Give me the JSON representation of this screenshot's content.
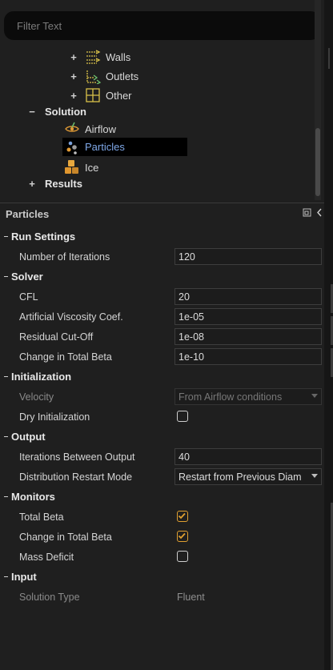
{
  "search": {
    "placeholder": "Filter Text"
  },
  "tree": {
    "items": [
      {
        "label": "Walls"
      },
      {
        "label": "Outlets"
      },
      {
        "label": "Other"
      },
      {
        "label": "Solution"
      },
      {
        "label": "Airflow"
      },
      {
        "label": "Particles"
      },
      {
        "label": "Ice"
      },
      {
        "label": "Results"
      }
    ]
  },
  "panel": {
    "title": "Particles"
  },
  "sections": {
    "run_settings": {
      "title": "Run Settings",
      "iterations_label": "Number of Iterations",
      "iterations_value": "120"
    },
    "solver": {
      "title": "Solver",
      "cfl_label": "CFL",
      "cfl_value": "20",
      "viscosity_label": "Artificial Viscosity Coef.",
      "viscosity_value": "1e-05",
      "residual_label": "Residual Cut-Off",
      "residual_value": "1e-08",
      "beta_label": "Change in Total Beta",
      "beta_value": "1e-10"
    },
    "initialization": {
      "title": "Initialization",
      "velocity_label": "Velocity",
      "velocity_value": "From Airflow conditions",
      "dry_label": "Dry Initialization",
      "dry_checked": false
    },
    "output": {
      "title": "Output",
      "iterations_label": "Iterations Between Output",
      "iterations_value": "40",
      "restart_label": "Distribution Restart Mode",
      "restart_value": "Restart from Previous Diam"
    },
    "monitors": {
      "title": "Monitors",
      "total_beta_label": "Total Beta",
      "total_beta_checked": true,
      "change_beta_label": "Change in Total Beta",
      "change_beta_checked": true,
      "mass_deficit_label": "Mass Deficit",
      "mass_deficit_checked": false
    },
    "input": {
      "title": "Input",
      "solution_type_label": "Solution Type",
      "solution_type_value": "Fluent"
    }
  },
  "colors": {
    "accent": "#e0a030",
    "selected_text": "#7fa8e8",
    "background": "#1f1f1f"
  },
  "icons": [
    "walls-icon",
    "outlets-icon",
    "other-icon",
    "airflow-icon",
    "particles-icon",
    "ice-icon",
    "detach-icon",
    "collapse-icon",
    "check-icon",
    "dropdown-caret-icon"
  ]
}
